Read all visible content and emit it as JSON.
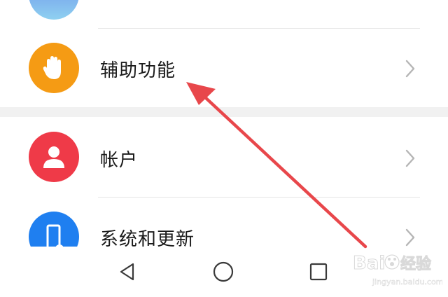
{
  "settings": {
    "items": [
      {
        "label": "",
        "icon": "partial-circle-icon",
        "color": "#8fb8f0"
      },
      {
        "label": "辅助功能",
        "icon": "hand-icon",
        "color": "#f59b14"
      },
      {
        "label": "帐户",
        "icon": "user-icon",
        "color": "#ef3a48"
      },
      {
        "label": "系统和更新",
        "icon": "phone-gear-icon",
        "color": "#1f7ff0"
      }
    ]
  },
  "annotation": {
    "arrow_color": "#e8474b"
  },
  "watermark": {
    "brand": "Bai",
    "brand_suffix": "du",
    "jingyan": "经验",
    "url": "jingyan.baidu.com"
  }
}
